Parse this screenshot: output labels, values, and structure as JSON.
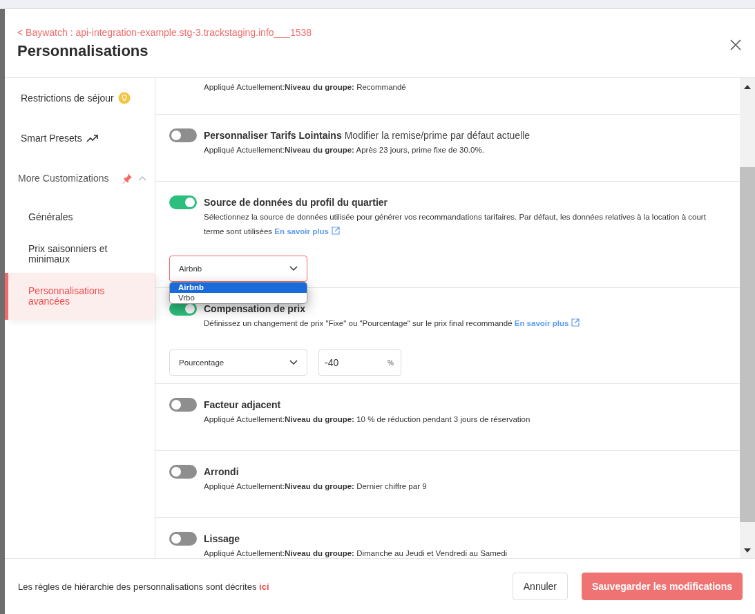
{
  "header": {
    "back_link": "< Baywatch : api-integration-example.stg-3.trackstaging.info___1538",
    "title": "Personnalisations"
  },
  "sidebar": {
    "items": [
      {
        "label": "Restrictions de séjour",
        "selected": false
      },
      {
        "label": "Smart Presets",
        "selected": false
      },
      {
        "label": "More Customizations",
        "expanded": true,
        "selected": false,
        "children": [
          {
            "label": "Générales",
            "selected": false
          },
          {
            "label": "Prix saisonniers et minimaux",
            "selected": false
          },
          {
            "label": "Personnalisations avancées",
            "selected": true
          }
        ]
      }
    ]
  },
  "sections": [
    {
      "kind": "partial",
      "applied": "Appliqué Actuellement:**Niveau du groupe:** Recommandé"
    },
    {
      "kind": "toggle",
      "on": false,
      "title": "Personnaliser Tarifs Lointains",
      "subtitle": "Modifier la remise/prime par défaut actuelle",
      "applied": "Appliqué Actuellement:**Niveau du groupe:** Après 23 jours, prime fixe de 30.0%."
    },
    {
      "kind": "select",
      "on": true,
      "title": "Source de données du profil du quartier",
      "description": "Sélectionnez la source de données utilisée pour générer vos recommandations tarifaires. Par défaut, les données relatives à la location à court terme sont utilisées",
      "link": "En savoir plus",
      "select": {
        "value": "Airbnb",
        "open": true,
        "options": [
          {
            "label": "Airbnb",
            "selected": true
          },
          {
            "label": "Vrbo",
            "selected": false
          }
        ]
      }
    },
    {
      "kind": "offset",
      "on": true,
      "title": "Compensation de prix",
      "description": "Définissez un changement de prix \"Fixe\" ou \"Pourcentage\" sur le prix final recommandé",
      "link": "En savoir plus",
      "select": {
        "value": "Pourcentage",
        "open": false
      },
      "amount": {
        "value": "-40",
        "unit": "%"
      }
    },
    {
      "kind": "toggle",
      "on": false,
      "title": "Facteur adjacent",
      "applied": "Appliqué Actuellement:**Niveau du groupe:** 10 % de réduction pendant 3 jours de réservation"
    },
    {
      "kind": "toggle",
      "on": false,
      "title": "Arrondi",
      "applied": "Appliqué Actuellement:**Niveau du groupe:** Dernier chiffre par 9"
    },
    {
      "kind": "toggle",
      "on": false,
      "title": "Lissage",
      "applied": "Appliqué Actuellement:**Niveau du groupe:** Dimanche au Jeudi et Vendredi au Samedi"
    }
  ],
  "footer": {
    "note": "Les règles de hiérarchie des personnalisations sont décrites",
    "note_link": "ici",
    "buttons": [
      {
        "label": "Annuler",
        "kind": "secondary"
      },
      {
        "label": "Sauvegarder les modifications",
        "kind": "primary"
      }
    ]
  }
}
